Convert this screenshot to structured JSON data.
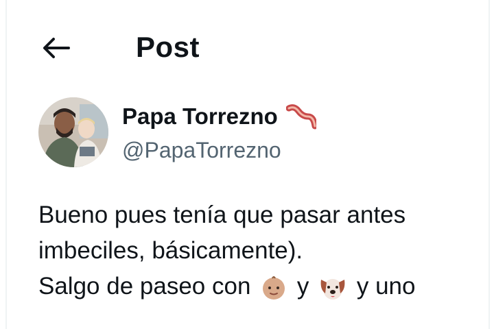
{
  "header": {
    "back_icon": "arrow-left-icon",
    "title": "Post"
  },
  "author": {
    "display_name": "Papa Torrezno",
    "name_emoji": "bacon-emoji",
    "handle": "@PapaTorrezno"
  },
  "post": {
    "line1": "Bueno pues tenía que pasar antes",
    "line2": "imbeciles, básicamente).",
    "line3_a": "Salgo de paseo con",
    "line3_b": "y",
    "line3_c": "y uno",
    "line3_emoji1": "baby-face-emoji",
    "line3_emoji2": "dog-face-emoji"
  },
  "colors": {
    "text": "#0f1419",
    "secondary_text": "#536471",
    "border": "#eff3f4",
    "background": "#ffffff"
  }
}
